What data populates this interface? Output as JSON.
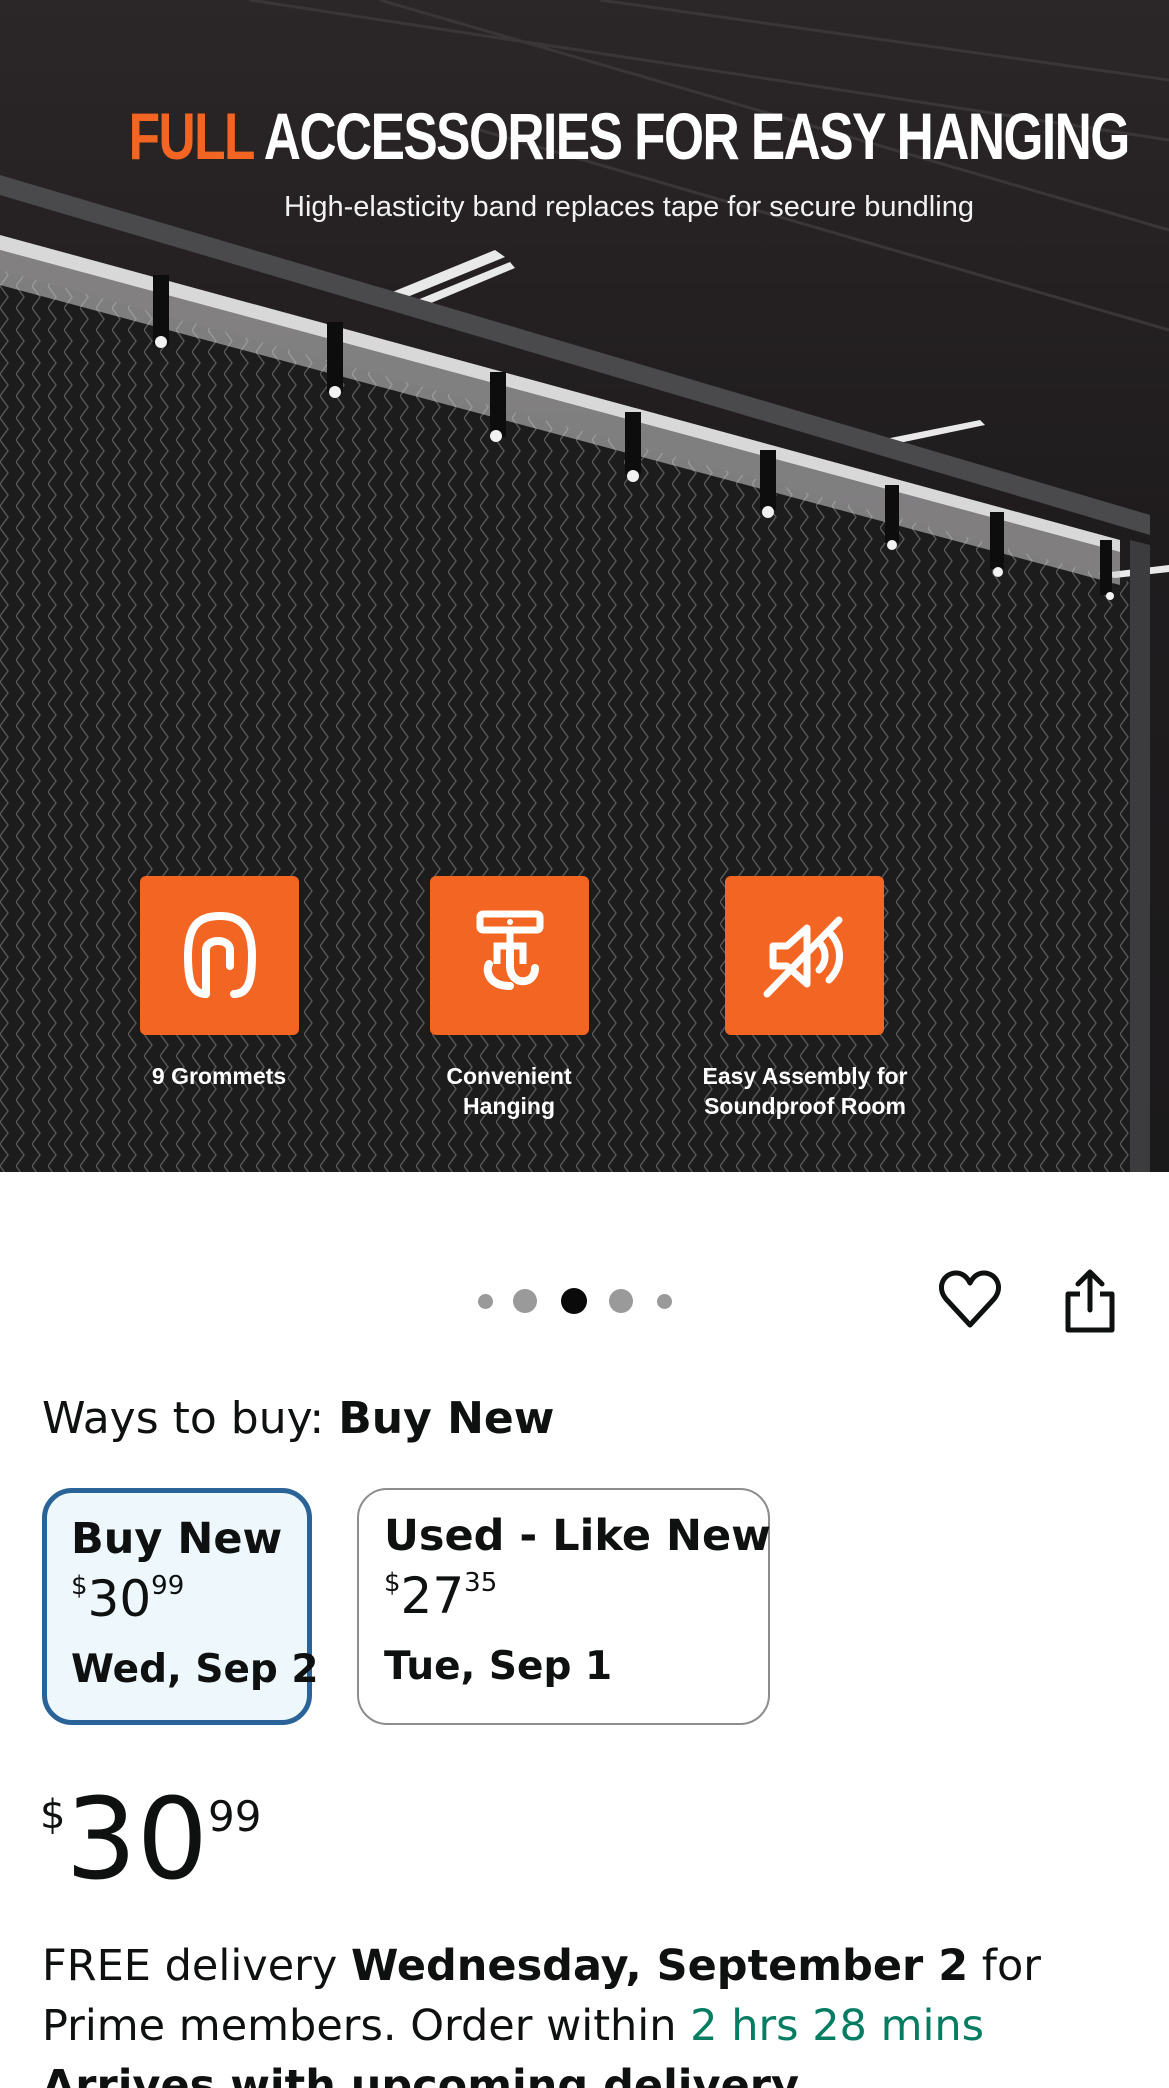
{
  "hero": {
    "title_accent": "FULL",
    "title_rest": " ACCESSORIES FOR EASY HANGING",
    "subtitle": "High-elasticity band replaces tape for secure bundling",
    "features": [
      {
        "icon": "carabiner-icon",
        "caption": "9 Grommets"
      },
      {
        "icon": "hook-icon",
        "caption": "Convenient\nHanging"
      },
      {
        "icon": "soundproof-icon",
        "caption": "Easy Assembly for\nSoundproof Room"
      }
    ],
    "accent_color": "#f26522"
  },
  "carousel": {
    "slide_count": 5,
    "active_index": 2
  },
  "actions": {
    "wishlist_icon": "heart-icon",
    "share_icon": "share-icon"
  },
  "ways_to_buy": {
    "label": "Ways to buy:",
    "selected": "Buy New",
    "options": [
      {
        "name": "Buy New",
        "currency": "$",
        "whole": "30",
        "cents": "99",
        "date": "Wed, Sep 2"
      },
      {
        "name": "Used - Like New",
        "currency": "$",
        "whole": "27",
        "cents": "35",
        "date": "Tue, Sep 1"
      }
    ]
  },
  "price": {
    "currency": "$",
    "whole": "30",
    "cents": "99"
  },
  "delivery": {
    "prefix": "FREE delivery ",
    "date": "Wednesday, September 2",
    "middle": " for Prime members. Order within ",
    "countdown": "2 hrs 28 mins",
    "next_line": "Arrives with upcoming delivery"
  },
  "colors": {
    "selected_border": "#2a6398",
    "selected_bg": "#edf7fc",
    "countdown": "#067d62"
  }
}
